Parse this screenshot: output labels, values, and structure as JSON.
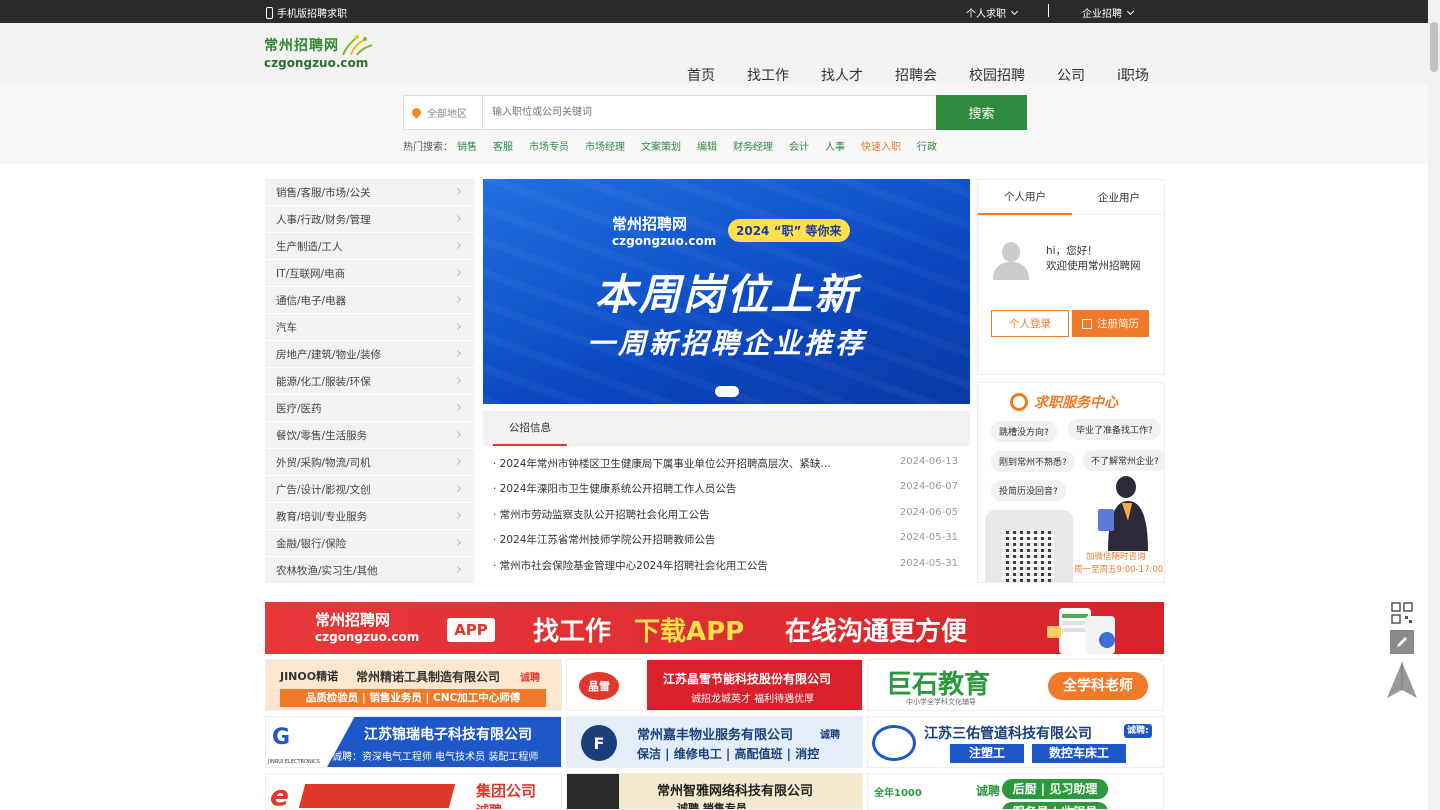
{
  "topbar": {
    "mobile": "手机版招聘求职",
    "personal": "个人求职",
    "company": "企业招聘"
  },
  "logo": {
    "cn": "常州招聘网",
    "en": "czgongzuo.com"
  },
  "nav": [
    "首页",
    "找工作",
    "找人才",
    "招聘会",
    "校园招聘",
    "公司",
    "i职场"
  ],
  "search": {
    "area": "全部地区",
    "placeholder": "输入职位或公司关键词",
    "button": "搜索",
    "hot_label": "热门搜索：",
    "hot": [
      "销售",
      "客服",
      "市场专员",
      "市场经理",
      "文案策划",
      "编辑",
      "财务经理",
      "会计",
      "人事",
      "快速入职",
      "行政"
    ]
  },
  "categories": [
    "销售/客服/市场/公关",
    "人事/行政/财务/管理",
    "生产制造/工人",
    "IT/互联网/电商",
    "通信/电子/电器",
    "汽车",
    "房地产/建筑/物业/装修",
    "能源/化工/服装/环保",
    "医疗/医药",
    "餐饮/零售/生活服务",
    "外贸/采购/物流/司机",
    "广告/设计/影视/文创",
    "教育/培训/专业服务",
    "金融/银行/保险",
    "农林牧渔/实习生/其他"
  ],
  "banner": {
    "logo_cn": "常州招聘网",
    "logo_en": "czgongzuo.com",
    "tag": "2024 “职” 等你来",
    "headline": "本周岗位上新",
    "subline": "一周新招聘企业推荐"
  },
  "notices": {
    "tab": "公招信息",
    "items": [
      {
        "title": "2024年常州市钟楼区卫生健康局下属事业单位公开招聘高层次、紧缺…",
        "date": "2024-06-13"
      },
      {
        "title": "2024年溧阳市卫生健康系统公开招聘工作人员公告",
        "date": "2024-06-07"
      },
      {
        "title": "常州市劳动监察支队公开招聘社会化用工公告",
        "date": "2024-06-05"
      },
      {
        "title": "2024年江苏省常州技师学院公开招聘教师公告",
        "date": "2024-05-31"
      },
      {
        "title": "常州市社会保险基金管理中心2024年招聘社会化用工公告",
        "date": "2024-05-31"
      }
    ]
  },
  "user": {
    "tab_personal": "个人用户",
    "tab_company": "企业用户",
    "hi": "hi，您好！",
    "welcome": "欢迎使用常州招聘网",
    "login": "个人登录",
    "register": "注册简历"
  },
  "service": {
    "title": "求职服务中心",
    "bubbles": [
      "跳槽没方向?",
      "毕业了准备找工作?",
      "刚到常州不熟悉?",
      "不了解常州企业?",
      "投简历没回音?"
    ],
    "caption1": "加微信随时咨询",
    "caption2": "周一至周五9:00-17:00"
  },
  "app_banner": {
    "logo_cn": "常州招聘网",
    "logo_en": "czgongzuo.com",
    "app": "APP",
    "s1": "找工作",
    "s2": "下载APP",
    "s3": "在线沟通更方便"
  },
  "ads": [
    {
      "brand": "JINOO精诺",
      "name": "常州精诺工具制造有限公司",
      "tag": "诚聘",
      "sub": "品质检验员 | 销售业务员 | CNC加工中心师傅"
    },
    {
      "brand": "晶雪",
      "name": "江苏晶雪节能科技股份有限公司",
      "sub": "诚招龙城英才  福利待遇优厚"
    },
    {
      "brand": "巨石教育",
      "name": "全学科老师",
      "sub": "中小学全学科文化辅导"
    },
    {
      "brand": "JINRUI ELECTRONICS",
      "name": "江苏锦瑞电子科技有限公司",
      "sub": "诚聘：资深电气工程师  电气技术员  装配工程师"
    },
    {
      "brand": "",
      "name": "常州嘉丰物业服务有限公司",
      "tag": "诚聘",
      "sub": "保洁 | 维修电工 | 高配值班 | 消控"
    },
    {
      "brand": "",
      "name": "江苏三佑管道科技有限公司",
      "tag": "诚聘:",
      "sub1": "注塑工",
      "sub2": "数控车床工"
    },
    {
      "brand": "",
      "name": "集团公司",
      "sub": "诚聘"
    },
    {
      "brand": "",
      "name": "常州智雅网络科技有限公司",
      "sub": "诚聘  销售专员"
    },
    {
      "brand": "全年1000",
      "name": "后厨 | 见习助理",
      "tag": "诚聘",
      "sub": "服务员 | 收银员"
    }
  ],
  "colors": {
    "brand_green": "#2e8b3d",
    "accent_orange": "#f07a2a",
    "banner_blue": "#0b48c2",
    "app_red": "#e2382c"
  }
}
